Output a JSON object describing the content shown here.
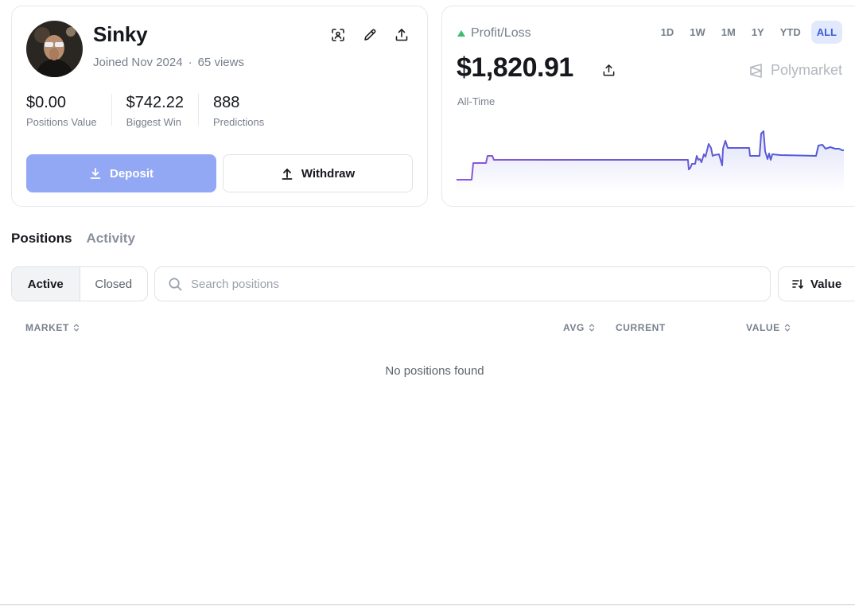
{
  "profile": {
    "username": "Sinky",
    "joined": "Joined Nov 2024",
    "separator": "·",
    "views": "65 views",
    "action_icons": [
      "scan-icon",
      "pencil-icon",
      "share-icon"
    ],
    "stats": [
      {
        "value": "$0.00",
        "label": "Positions Value"
      },
      {
        "value": "$742.22",
        "label": "Biggest Win"
      },
      {
        "value": "888",
        "label": "Predictions"
      }
    ],
    "deposit_label": "Deposit",
    "withdraw_label": "Withdraw"
  },
  "pnl": {
    "label": "Profit/Loss",
    "value": "$1,820.91",
    "period": "All-Time",
    "brand": "Polymarket",
    "ranges": [
      "1D",
      "1W",
      "1M",
      "1Y",
      "YTD",
      "ALL"
    ],
    "active_range": "ALL"
  },
  "tabs": {
    "positions": "Positions",
    "activity": "Activity"
  },
  "filters": {
    "active": "Active",
    "closed": "Closed",
    "search_placeholder": "Search positions",
    "sort_label": "Value"
  },
  "table": {
    "columns": [
      "MARKET",
      "AVG",
      "CURRENT",
      "VALUE"
    ],
    "empty_text": "No positions found"
  },
  "colors": {
    "accent": "#93a8f4",
    "chart_line": "#5560d6",
    "positive": "#3dbb71"
  }
}
